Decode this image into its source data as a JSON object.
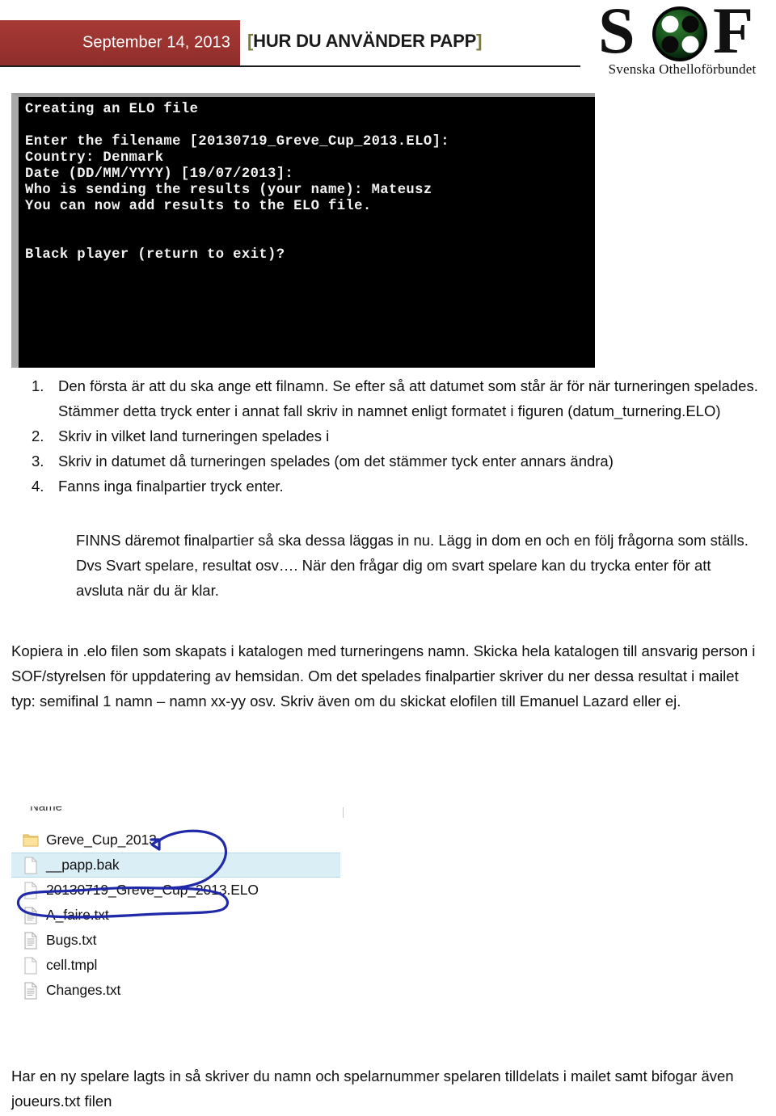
{
  "header": {
    "date": "September 14, 2013",
    "title_open_bracket": "[",
    "title": "HUR DU ANVÄNDER PAPP",
    "title_close_bracket": "]",
    "accent_red": "#9D3531",
    "bracket_color": "#7A7A3C"
  },
  "logo": {
    "letter_s": "S",
    "letter_f": "F",
    "caption": "Svenska Othelloförbundet",
    "board_color": "#1b4d1b",
    "disc_light": "#ffffff",
    "disc_dark": "#0a0a0a"
  },
  "terminal": {
    "lines": "Creating an ELO file\n\nEnter the filename [20130719_Greve_Cup_2013.ELO]:\nCountry: Denmark\nDate (DD/MM/YYYY) [19/07/2013]:\nWho is sending the results (your name): Mateusz\nYou can now add results to the ELO file.\n\n\nBlack player (return to exit)?",
    "background": "#000000",
    "foreground": "#F2F2F2"
  },
  "steps": [
    "Den första är att du ska ange ett filnamn. Se efter så att datumet som står är för när turneringen spelades. Stämmer detta tryck enter i annat fall skriv in namnet enligt formatet i figuren (datum_turnering.ELO)",
    "Skriv in vilket land turneringen spelades i",
    "Skriv in datumet då turneringen spelades (om det stämmer tyck enter annars ändra)",
    "Fanns inga finalpartier tryck enter."
  ],
  "paragraphs": {
    "finals": "FINNS däremot finalpartier så ska dessa läggas in nu. Lägg in dom en och en följ frågorna som ställs. Dvs Svart spelare, resultat osv…. När den frågar dig om svart spelare kan du trycka enter för att avsluta när du är klar.",
    "copy": "Kopiera in .elo filen som skapats i katalogen med turneringens namn. Skicka hela katalogen till ansvarig person i SOF/styrelsen för uppdatering av hemsidan. Om det spelades finalpartier skriver du ner dessa resultat i mailet typ: semifinal 1 namn – namn  xx-yy osv. Skriv även om du skickat elofilen till Emanuel Lazard eller ej.",
    "newplayer": "Har en ny spelare lagts in så skriver du namn och spelarnummer spelaren tilldelats i mailet samt bifogar även joueurs.txt filen"
  },
  "filelist": {
    "column_header": "Name",
    "selected_row_color": "#DAEEF5",
    "annotation_ink_color": "#2029A8",
    "rows": [
      {
        "name": "Greve_Cup_2013",
        "type": "folder",
        "selected": false
      },
      {
        "name": "__papp.bak",
        "type": "file",
        "selected": true
      },
      {
        "name": "20130719_Greve_Cup_2013.ELO",
        "type": "file",
        "selected": false
      },
      {
        "name": "A_faire.txt",
        "type": "text",
        "selected": false
      },
      {
        "name": "Bugs.txt",
        "type": "text",
        "selected": false
      },
      {
        "name": "cell.tmpl",
        "type": "file",
        "selected": false
      },
      {
        "name": "Changes.txt",
        "type": "text",
        "selected": false
      }
    ]
  }
}
